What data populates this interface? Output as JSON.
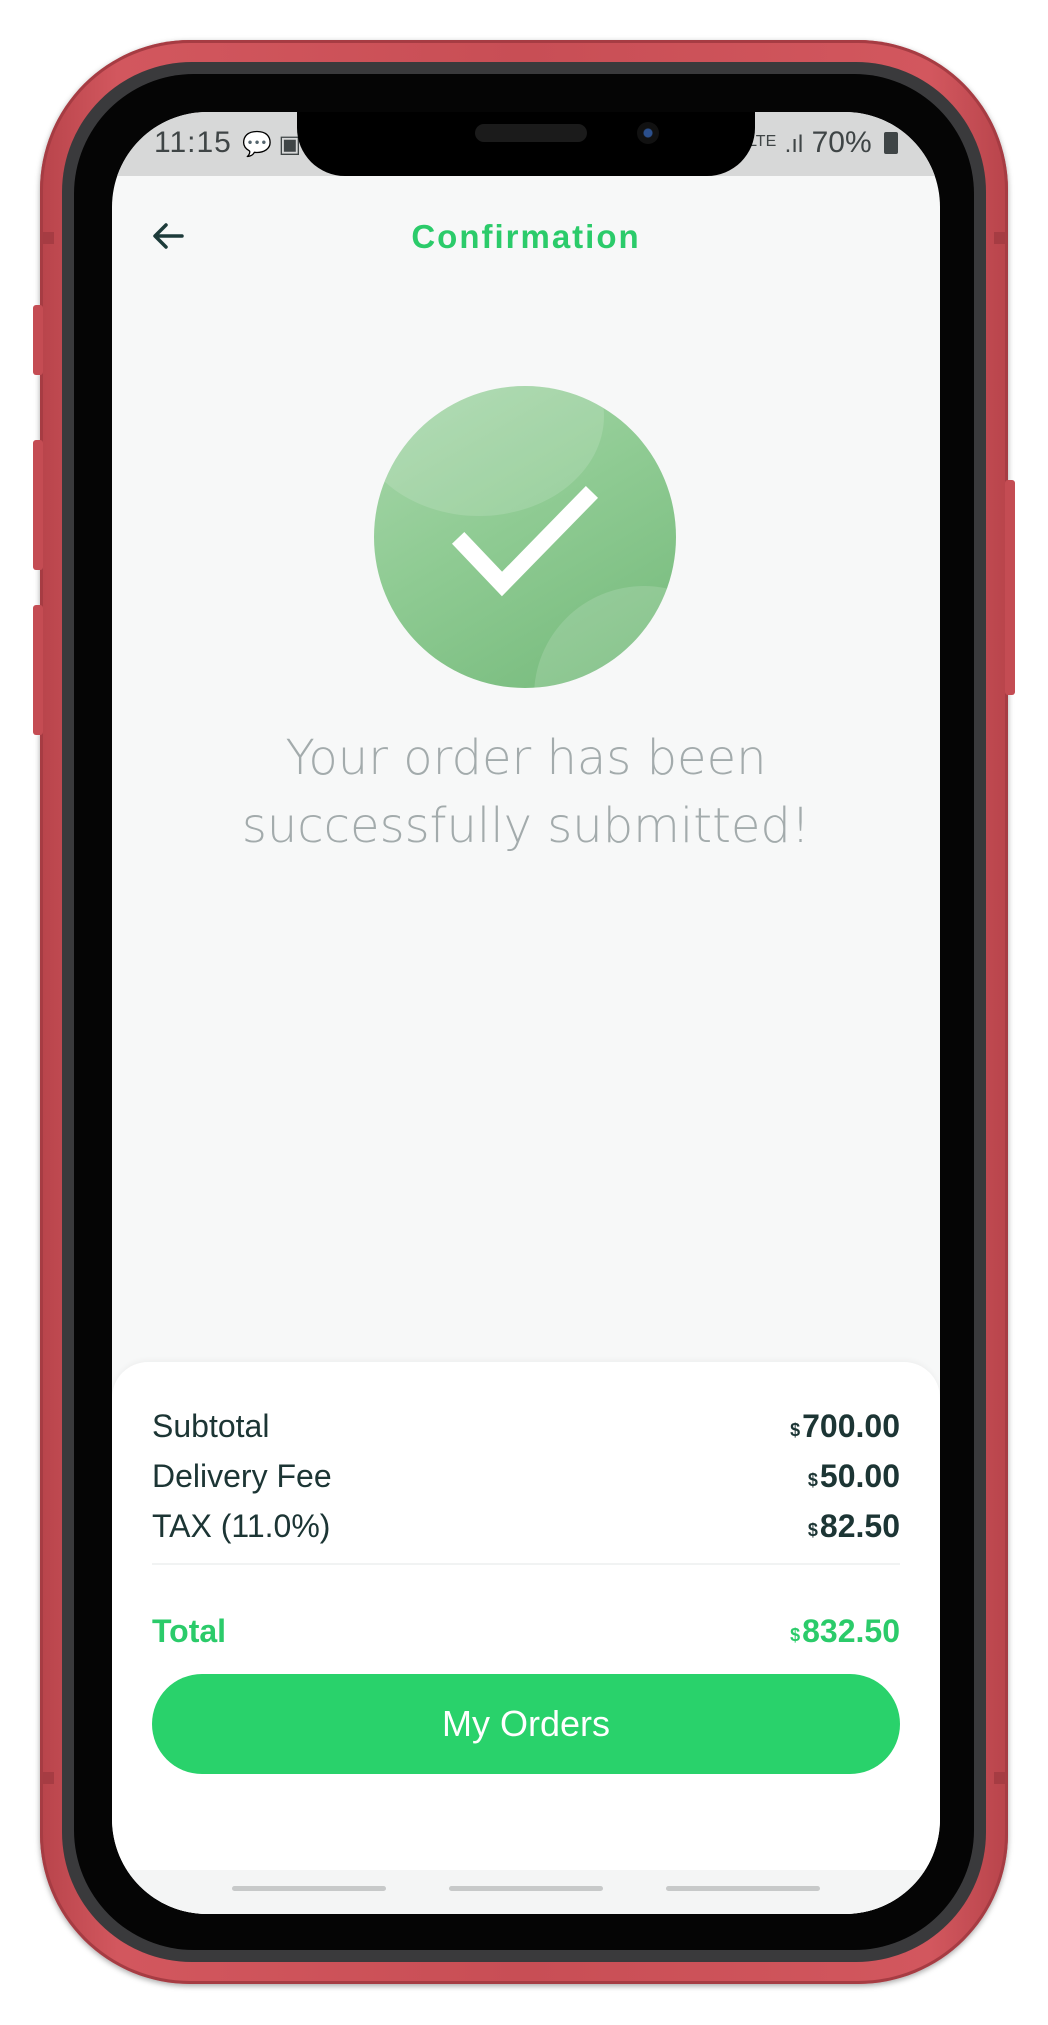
{
  "status_bar": {
    "time": "11:15",
    "left_icons": "💬 ▣",
    "network": "LTE",
    "signal": ".ıl",
    "battery": "70%"
  },
  "header": {
    "title": "Confirmation"
  },
  "confirmation": {
    "message": "Your order has been successfully submitted!",
    "icon": "checkmark-circle-icon"
  },
  "summary": {
    "currency_symbol": "$",
    "subtotal_label": "Subtotal",
    "subtotal_value": "700.00",
    "delivery_label": "Delivery Fee",
    "delivery_value": "50.00",
    "tax_label": "TAX (11.0%)",
    "tax_value": "82.50",
    "total_label": "Total",
    "total_value": "832.50"
  },
  "actions": {
    "my_orders_label": "My Orders"
  },
  "colors": {
    "accent": "#2bcb6a",
    "button": "#29d26b",
    "frame": "#c84e55"
  }
}
